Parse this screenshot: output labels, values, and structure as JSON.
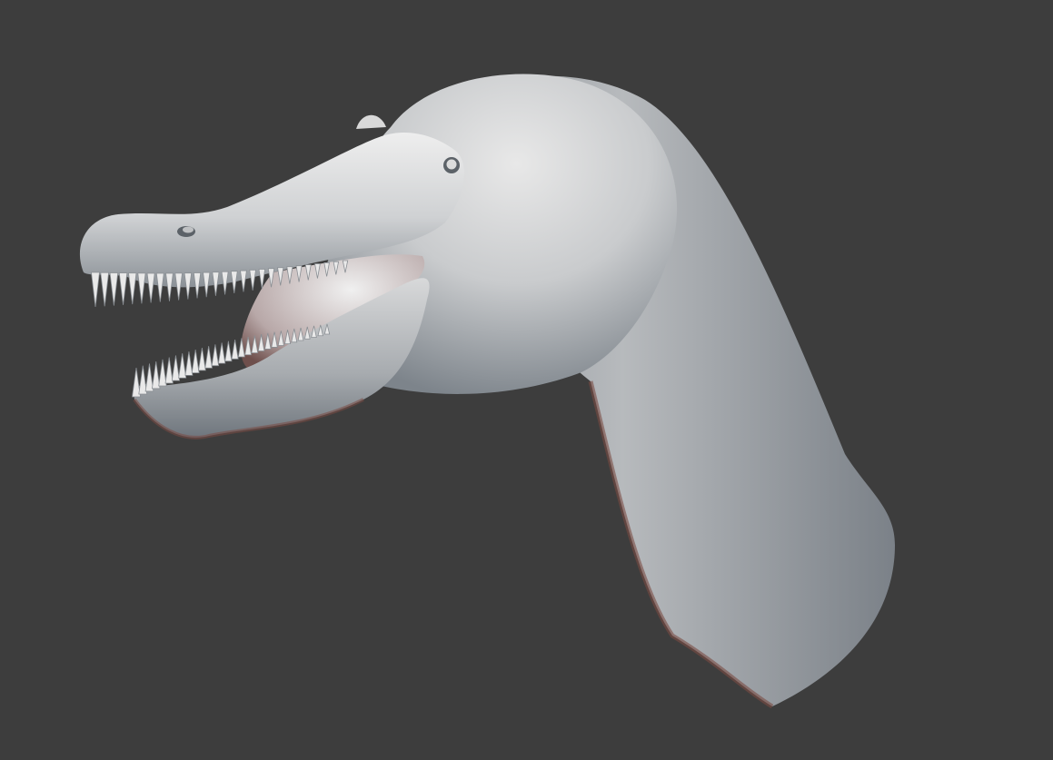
{
  "viewport": {
    "background_color": "#3d3d3d"
  },
  "model": {
    "subject": "spinosaur-head-and-neck",
    "material_color": "#dcdcdc",
    "shadow_color": "#6f7880",
    "rim_color": "#7a4b43",
    "teeth": {
      "upper_count": 28,
      "lower_count": 30
    }
  }
}
